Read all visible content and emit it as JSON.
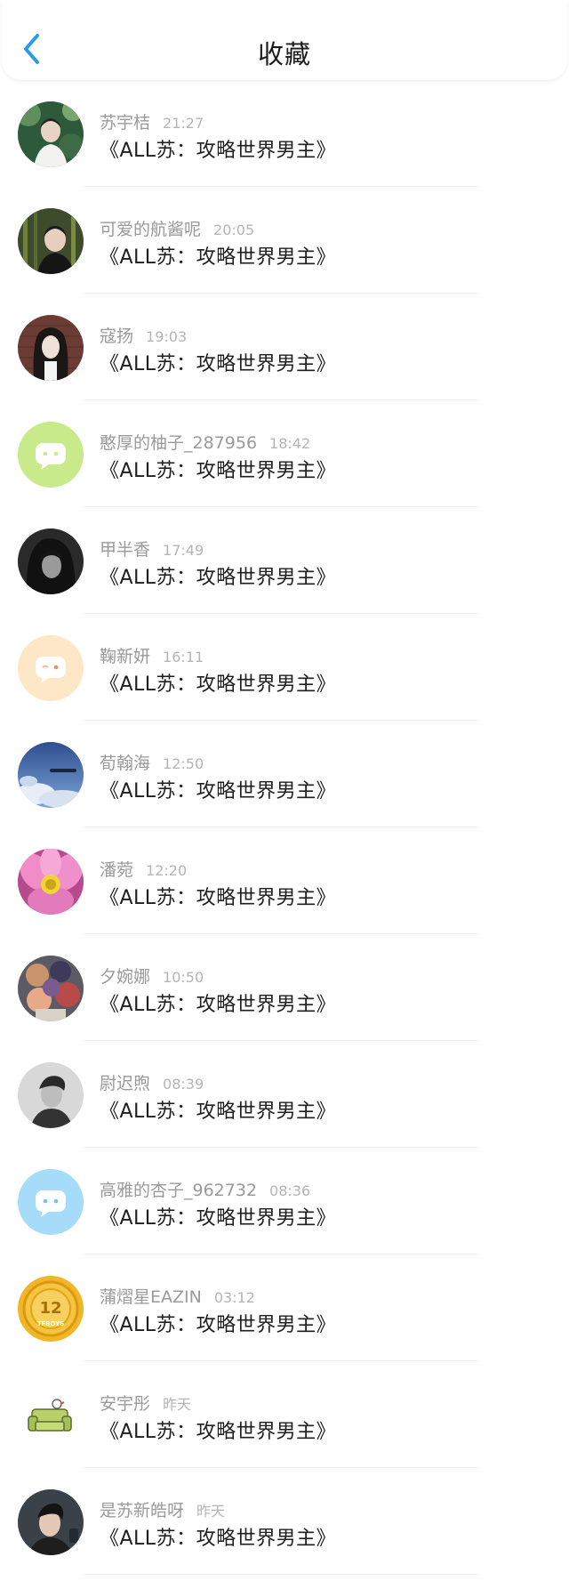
{
  "header": {
    "title": "收藏",
    "back_icon": "chevron-left-icon",
    "accent_color": "#2a9bea"
  },
  "items": [
    {
      "name": "苏宇桔",
      "time": "21:27",
      "book": "《ALL苏：攻略世界男主》",
      "avatar": "photo-forest"
    },
    {
      "name": "可爱的航酱呢",
      "time": "20:05",
      "book": "《ALL苏：攻略世界男主》",
      "avatar": "photo-man-bamboo"
    },
    {
      "name": "寇扬",
      "time": "19:03",
      "book": "《ALL苏：攻略世界男主》",
      "avatar": "photo-girl-brick"
    },
    {
      "name": "憨厚的柚子_287956",
      "time": "18:42",
      "book": "《ALL苏：攻略世界男主》",
      "avatar": "chat-bubble-green"
    },
    {
      "name": "甲半香",
      "time": "17:49",
      "book": "《ALL苏：攻略世界男主》",
      "avatar": "photo-dark-girl"
    },
    {
      "name": "鞠新妍",
      "time": "16:11",
      "book": "《ALL苏：攻略世界男主》",
      "avatar": "chat-bubble-peach"
    },
    {
      "name": "荀翰海",
      "time": "12:50",
      "book": "《ALL苏：攻略世界男主》",
      "avatar": "photo-sky"
    },
    {
      "name": "潘菀",
      "time": "12:20",
      "book": "《ALL苏：攻略世界男主》",
      "avatar": "photo-lotus"
    },
    {
      "name": "夕婉娜",
      "time": "10:50",
      "book": "《ALL苏：攻略世界男主》",
      "avatar": "photo-flowers"
    },
    {
      "name": "尉迟煦",
      "time": "08:39",
      "book": "《ALL苏：攻略世界男主》",
      "avatar": "photo-bw-man"
    },
    {
      "name": "高雅的杏子_962732",
      "time": "08:36",
      "book": "《ALL苏：攻略世界男主》",
      "avatar": "chat-bubble-blue"
    },
    {
      "name": "蒲熠星EAZIN",
      "time": "03:12",
      "book": "《ALL苏：攻略世界男主》",
      "avatar": "gold-badge"
    },
    {
      "name": "安宇彤",
      "time": "昨天",
      "book": "《ALL苏：攻略世界男主》",
      "avatar": "sofa-illustration"
    },
    {
      "name": "是苏新皓呀",
      "time": "昨天",
      "book": "《ALL苏：攻略世界男主》",
      "avatar": "photo-young-man"
    }
  ],
  "badge_text": {
    "number": "12",
    "brand": "TFBOYS"
  }
}
